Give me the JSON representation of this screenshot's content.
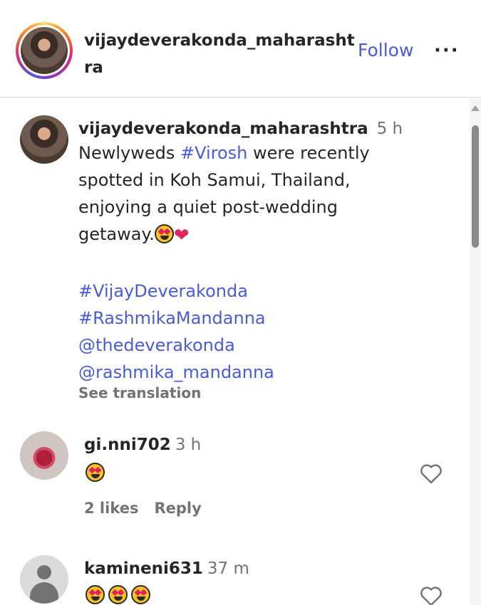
{
  "header": {
    "username": "vijaydeverakonda_maharashtra",
    "follow_label": "Follow",
    "more_icon": "more-horizontal-icon"
  },
  "post": {
    "username": "vijaydeverakonda_maharashtra",
    "time": "5 h",
    "caption_before": "Newlyweds ",
    "caption_hashtag": "#Virosh",
    "caption_after": " were recently spotted in Koh Samui, Thailand, enjoying a quiet post-wedding getaway.",
    "tags": [
      "#VijayDeverakonda",
      "#RashmikaMandanna",
      "@thedeverakonda",
      "@rashmika_mandanna"
    ],
    "see_translation": "See translation"
  },
  "comments": [
    {
      "username": "gi.nni702",
      "time": "3 h",
      "emoji_count": 1,
      "likes": "2 likes",
      "reply": "Reply"
    },
    {
      "username": "kamineni631",
      "time": "37 m",
      "emoji_count": 3
    }
  ],
  "colors": {
    "link": "#4a5bd8",
    "muted": "#737373",
    "text": "#262626",
    "heart": "#e0245e"
  }
}
